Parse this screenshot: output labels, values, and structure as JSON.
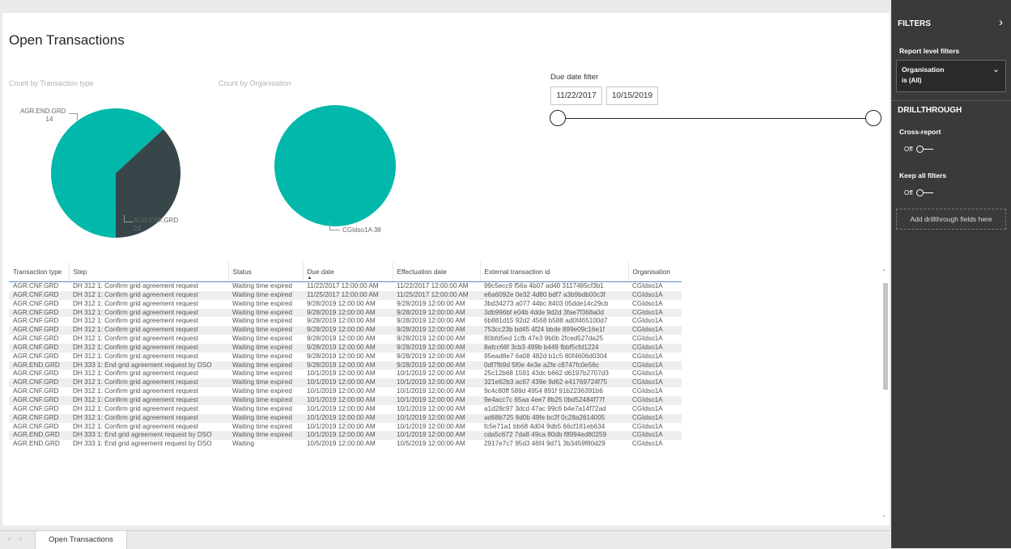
{
  "page_title": "Open Transactions",
  "charts": {
    "type_chart": {
      "title": "Count by Transaction type",
      "colors": {
        "AGR.END.GRD": "#374649",
        "AGR.CNF.GRD": "#01b8aa"
      }
    },
    "org_chart": {
      "title": "Count by Organisation",
      "colors": {
        "CGIdso1A": "#01b8aa"
      }
    }
  },
  "chart_data": [
    {
      "type": "pie",
      "title": "Count by Transaction type",
      "slices": [
        {
          "label": "AGR.END.GRD",
          "value": 14
        },
        {
          "label": "AGR.CNF.GRD",
          "value": 24
        }
      ]
    },
    {
      "type": "pie",
      "title": "Count by Organisation",
      "slices": [
        {
          "label": "CGIdso1A",
          "value": 38
        }
      ]
    }
  ],
  "date_slicer": {
    "title": "Due date filter",
    "start": "11/22/2017",
    "end": "10/15/2019"
  },
  "table": {
    "columns": [
      "Transaction type",
      "Step",
      "Status",
      "Due date",
      "Effectuation date",
      "External transaction id",
      "Organisation"
    ],
    "sort_indicator": "▲",
    "rows": [
      [
        "AGR.CNF.GRD",
        "DH 312 1: Confirm grid agreement request",
        "Waiting time expired",
        "11/22/2017 12:00:00 AM",
        "11/22/2017 12:00:00 AM",
        "99c5ecc9 f56a 4b07 ad40 3117485cf3b1",
        "CGIdso1A"
      ],
      [
        "AGR.CNF.GRD",
        "DH 312 1: Confirm grid agreement request",
        "Waiting time expired",
        "11/25/2017 12:00:00 AM",
        "11/25/2017 12:00:00 AM",
        "e6a6092e 0e32 4d80 bdf7 a3b9bdb00c3f",
        "CGIdso1A"
      ],
      [
        "AGR.CNF.GRD",
        "DH 312 1: Confirm grid agreement request",
        "Waiting time expired",
        "9/28/2019 12:00:00 AM",
        "9/28/2019 12:00:00 AM",
        "3bd34273 a077 44bc 8403 05dde14c29cb",
        "CGIdso1A"
      ],
      [
        "AGR.CNF.GRD",
        "DH 312 1: Confirm grid agreement request",
        "Waiting time expired",
        "9/28/2019 12:00:00 AM",
        "9/28/2019 12:00:00 AM",
        "3db996bf e04b 4dde 9d2d 3fae7f368a0d",
        "CGIdso1A"
      ],
      [
        "AGR.CNF.GRD",
        "DH 312 1: Confirm grid agreement request",
        "Waiting time expired",
        "9/28/2019 12:00:00 AM",
        "9/28/2019 12:00:00 AM",
        "6b881d15 92d2 4568 b588 ad0f465100d7",
        "CGIdso1A"
      ],
      [
        "AGR.CNF.GRD",
        "DH 312 1: Confirm grid agreement request",
        "Waiting time expired",
        "9/28/2019 12:00:00 AM",
        "9/28/2019 12:00:00 AM",
        "753cc23b bd45 4f24 bbde 899e09c16e1f",
        "CGIdso1A"
      ],
      [
        "AGR.CNF.GRD",
        "DH 312 1: Confirm grid agreement request",
        "Waiting time expired",
        "9/28/2019 12:00:00 AM",
        "9/28/2019 12:00:00 AM",
        "80bfd5ed 1cfb 47e3 9b0b 2fced527da25",
        "CGIdso1A"
      ],
      [
        "AGR.CNF.GRD",
        "DH 312 1: Confirm grid agreement request",
        "Waiting time expired",
        "9/28/2019 12:00:00 AM",
        "9/28/2019 12:00:00 AM",
        "8afcc66f 3cb3 499b b449 fbbf5cfd1224",
        "CGIdso1A"
      ],
      [
        "AGR.CNF.GRD",
        "DH 312 1: Confirm grid agreement request",
        "Waiting time expired",
        "9/28/2019 12:00:00 AM",
        "9/28/2019 12:00:00 AM",
        "95ead8e7 6a08 482d b1c5 80f4606d0304",
        "CGIdso1A"
      ],
      [
        "AGR.END.GRD",
        "DH 333 1: End grid agreement request by DSO",
        "Waiting time expired",
        "9/28/2019 12:00:00 AM",
        "9/28/2019 12:00:00 AM",
        "0df7fb9d 5f0e 4e3e a2fe c8747fc0e56c",
        "CGIdso1A"
      ],
      [
        "AGR.CNF.GRD",
        "DH 312 1: Confirm grid agreement request",
        "Waiting time expired",
        "10/1/2019 12:00:00 AM",
        "10/1/2019 12:00:00 AM",
        "25c12b68 1591 43dc b662 d6197b2707d3",
        "CGIdso1A"
      ],
      [
        "AGR.CNF.GRD",
        "DH 312 1: Confirm grid agreement request",
        "Waiting time expired",
        "10/1/2019 12:00:00 AM",
        "10/1/2019 12:00:00 AM",
        "321e62b3 ac67 439e 9d62 e41769724f75",
        "CGIdso1A"
      ],
      [
        "AGR.CNF.GRD",
        "DH 312 1: Confirm grid agreement request",
        "Waiting time expired",
        "10/1/2019 12:00:00 AM",
        "10/1/2019 12:00:00 AM",
        "9c4c80ff 589d 4954 891f 91b2236391b6",
        "CGIdso1A"
      ],
      [
        "AGR.CNF.GRD",
        "DH 312 1: Confirm grid agreement request",
        "Waiting time expired",
        "10/1/2019 12:00:00 AM",
        "10/1/2019 12:00:00 AM",
        "9e4acc7c 65aa 4ee7 8b25 0bd52484f77f",
        "CGIdso1A"
      ],
      [
        "AGR.CNF.GRD",
        "DH 312 1: Confirm grid agreement request",
        "Waiting time expired",
        "10/1/2019 12:00:00 AM",
        "10/1/2019 12:00:00 AM",
        "a1d28c97 3dcd 47ac 99c6 b4e7a14f72ad",
        "CGIdso1A"
      ],
      [
        "AGR.CNF.GRD",
        "DH 312 1: Confirm grid agreement request",
        "Waiting time expired",
        "10/1/2019 12:00:00 AM",
        "10/1/2019 12:00:00 AM",
        "ad68b725 8d0b 49fe bc2f 0c28a2614005",
        "CGIdso1A"
      ],
      [
        "AGR.CNF.GRD",
        "DH 312 1: Confirm grid agreement request",
        "Waiting time expired",
        "10/1/2019 12:00:00 AM",
        "10/1/2019 12:00:00 AM",
        "fc5e71a1 bb68 4d04 9db5 66cf181eb634",
        "CGIdso1A"
      ],
      [
        "AGR.END.GRD",
        "DH 333 1: End grid agreement request by DSO",
        "Waiting time expired",
        "10/1/2019 12:00:00 AM",
        "10/1/2019 12:00:00 AM",
        "cda5c672 7da8 49ca 80db f8994ed80259",
        "CGIdso1A"
      ],
      [
        "AGR.END.GRD",
        "DH 333 1: End grid agreement request by DSO",
        "Waiting",
        "10/5/2019 12:00:00 AM",
        "10/5/2019 12:00:00 AM",
        "2917e7c7 95d3 46f4 9d71 3b3459f80d29",
        "CGIdso1A"
      ]
    ]
  },
  "tabs": {
    "prev_icon": "‹",
    "next_icon": "›",
    "items": [
      "Open Transactions"
    ]
  },
  "filters_pane": {
    "title": "FILTERS",
    "collapse_icon": "›",
    "report_level_label": "Report level filters",
    "filter_card": {
      "field": "Organisation",
      "value": "is (All)"
    },
    "drillthrough_title": "DRILLTHROUGH",
    "cross_report": {
      "label": "Cross-report",
      "state": "Off"
    },
    "keep_all_filters": {
      "label": "Keep all filters",
      "state": "Off"
    },
    "drill_placeholder": "Add drillthrough fields here"
  }
}
